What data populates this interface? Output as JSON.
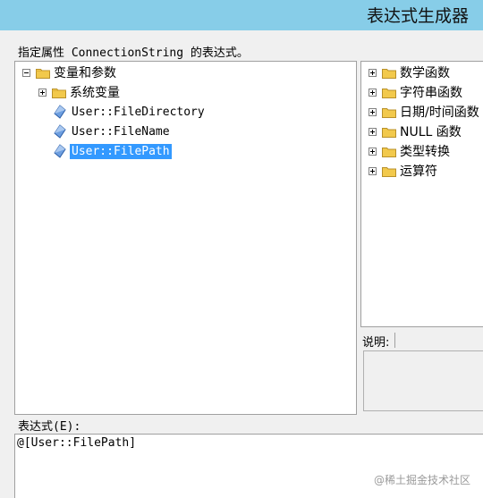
{
  "window": {
    "title": "表达式生成器"
  },
  "prompt_text": "指定属性 ConnectionString 的表达式。",
  "left_tree": {
    "root": {
      "label": "变量和参数",
      "expanded": true
    },
    "items": [
      {
        "label": "系统变量",
        "type": "folder",
        "expanded": false
      },
      {
        "label": "User::FileDirectory",
        "type": "variable"
      },
      {
        "label": "User::FileName",
        "type": "variable"
      },
      {
        "label": "User::FilePath",
        "type": "variable",
        "selected": true
      }
    ]
  },
  "right_tree": {
    "items": [
      {
        "label": "数学函数"
      },
      {
        "label": "字符串函数"
      },
      {
        "label": "日期/时间函数"
      },
      {
        "label": "NULL 函数"
      },
      {
        "label": "类型转换"
      },
      {
        "label": "运算符"
      }
    ]
  },
  "description": {
    "label": "说明:"
  },
  "expression": {
    "label": "表达式(E):",
    "value": "@[User::FilePath]"
  },
  "watermark": "@稀土掘金技术社区",
  "colors": {
    "titlebar": "#87cde8",
    "selection": "#3399ff",
    "folder": "#f2c94c"
  }
}
